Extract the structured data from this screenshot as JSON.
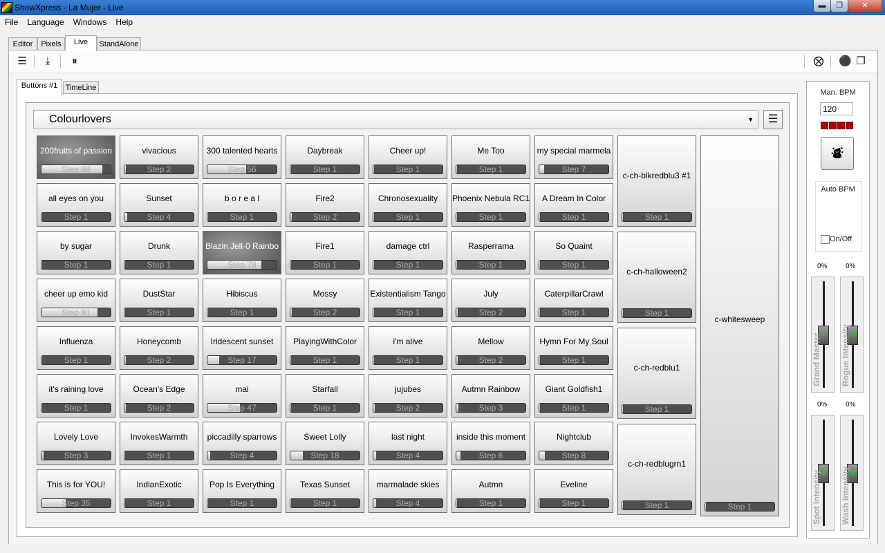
{
  "window": {
    "title": "ShowXpress - La Mujer - Live"
  },
  "menu": [
    "File",
    "Language",
    "Windows",
    "Help"
  ],
  "top_tabs": [
    "Editor",
    "Pixels",
    "Live",
    "StandAlone"
  ],
  "top_tabs_active": "Live",
  "inner_tabs": [
    "Buttons #1",
    "TimeLine"
  ],
  "inner_tabs_active": "Buttons #1",
  "page_select": {
    "value": "Colourlovers"
  },
  "grid": {
    "rows": [
      [
        {
          "name": "200fruits of passion",
          "step": "Step 88",
          "progress": 0.88,
          "active": true
        },
        {
          "name": "vivacious",
          "step": "Step 2",
          "progress": 0.02
        },
        {
          "name": "300 talented hearts",
          "step": "Step 56",
          "progress": 0.56
        },
        {
          "name": "Daybreak",
          "step": "Step 1",
          "progress": 0.01
        },
        {
          "name": "Cheer up!",
          "step": "Step 1",
          "progress": 0.01
        },
        {
          "name": "Me Too",
          "step": "Step 1",
          "progress": 0.01
        },
        {
          "name": "my special marmela",
          "step": "Step 7",
          "progress": 0.07
        }
      ],
      [
        {
          "name": "all eyes on you",
          "step": "Step 1",
          "progress": 0.01
        },
        {
          "name": "Sunset",
          "step": "Step 4",
          "progress": 0.04
        },
        {
          "name": "b o r e a l",
          "step": "Step 1",
          "progress": 0.01
        },
        {
          "name": "Fire2",
          "step": "Step 2",
          "progress": 0.02
        },
        {
          "name": "Chronosexuality",
          "step": "Step 1",
          "progress": 0.01
        },
        {
          "name": "Phoenix Nebula RC1",
          "step": "Step 1",
          "progress": 0.01
        },
        {
          "name": "A Dream In Color",
          "step": "Step 1",
          "progress": 0.01
        }
      ],
      [
        {
          "name": "by sugar",
          "step": "Step 1",
          "progress": 0.01
        },
        {
          "name": "Drunk",
          "step": "Step 1",
          "progress": 0.01
        },
        {
          "name": "Blazin Jell-0 Rainbo",
          "step": "Step 78",
          "progress": 0.78,
          "active": true
        },
        {
          "name": "Fire1",
          "step": "Step 1",
          "progress": 0.01
        },
        {
          "name": "damage ctrl",
          "step": "Step 1",
          "progress": 0.01
        },
        {
          "name": "Rasperrama",
          "step": "Step 1",
          "progress": 0.01
        },
        {
          "name": "So Quaint",
          "step": "Step 1",
          "progress": 0.01
        }
      ],
      [
        {
          "name": "cheer up emo kid",
          "step": "Step 81",
          "progress": 0.81
        },
        {
          "name": "DustStar",
          "step": "Step 1",
          "progress": 0.01
        },
        {
          "name": "Hibiscus",
          "step": "Step 1",
          "progress": 0.01
        },
        {
          "name": "Mossy",
          "step": "Step 2",
          "progress": 0.02
        },
        {
          "name": "Existentialism Tango",
          "step": "Step 1",
          "progress": 0.01
        },
        {
          "name": "July",
          "step": "Step 2",
          "progress": 0.02
        },
        {
          "name": "CaterpillarCrawl",
          "step": "Step 1",
          "progress": 0.01
        }
      ],
      [
        {
          "name": "Influenza",
          "step": "Step 1",
          "progress": 0.01
        },
        {
          "name": "Honeycomb",
          "step": "Step 2",
          "progress": 0.02
        },
        {
          "name": "Iridescent sunset",
          "step": "Step 17",
          "progress": 0.17
        },
        {
          "name": "PlayingWithColor",
          "step": "Step 1",
          "progress": 0.01
        },
        {
          "name": "i'm alive",
          "step": "Step 1",
          "progress": 0.01
        },
        {
          "name": "Mellow",
          "step": "Step 2",
          "progress": 0.02
        },
        {
          "name": "Hymn For My Soul",
          "step": "Step 1",
          "progress": 0.01
        }
      ],
      [
        {
          "name": "it's raining love",
          "step": "Step 1",
          "progress": 0.01
        },
        {
          "name": "Ocean's Edge",
          "step": "Step 2",
          "progress": 0.02
        },
        {
          "name": "mai",
          "step": "Step 47",
          "progress": 0.47
        },
        {
          "name": "Starfall",
          "step": "Step 1",
          "progress": 0.01
        },
        {
          "name": "jujubes",
          "step": "Step 2",
          "progress": 0.02
        },
        {
          "name": "Autmn Rainbow",
          "step": "Step 3",
          "progress": 0.03
        },
        {
          "name": "Giant Goldfish1",
          "step": "Step 1",
          "progress": 0.01
        }
      ],
      [
        {
          "name": "Lovely Love",
          "step": "Step 3",
          "progress": 0.03
        },
        {
          "name": "InvokesWarmth",
          "step": "Step 1",
          "progress": 0.01
        },
        {
          "name": "piccadilly sparrows",
          "step": "Step 4",
          "progress": 0.04
        },
        {
          "name": "Sweet Lolly",
          "step": "Step 18",
          "progress": 0.18
        },
        {
          "name": "last night",
          "step": "Step 4",
          "progress": 0.04
        },
        {
          "name": "inside this moment",
          "step": "Step 6",
          "progress": 0.06
        },
        {
          "name": "Nightclub",
          "step": "Step 8",
          "progress": 0.08
        }
      ],
      [
        {
          "name": "This is for YOU!",
          "step": "Step 35",
          "progress": 0.35
        },
        {
          "name": "IndianExotic",
          "step": "Step 1",
          "progress": 0.01
        },
        {
          "name": "Pop Is Everything",
          "step": "Step 1",
          "progress": 0.01
        },
        {
          "name": "Texas Sunset",
          "step": "Step 1",
          "progress": 0.01
        },
        {
          "name": "marmalade skies",
          "step": "Step 4",
          "progress": 0.04
        },
        {
          "name": "Autmn",
          "step": "Step 1",
          "progress": 0.01
        },
        {
          "name": "Eveline",
          "step": "Step 1",
          "progress": 0.01
        }
      ]
    ],
    "tall_buttons": [
      {
        "name": "c-ch-blkredblu3 #1",
        "step": "Step 1",
        "progress": 0.01
      },
      {
        "name": "c-ch-halloween2",
        "step": "Step 1",
        "progress": 0.01
      },
      {
        "name": "c-ch-redblu1",
        "step": "Step 1",
        "progress": 0.01
      },
      {
        "name": "c-ch-redblugrn1",
        "step": "Step 1",
        "progress": 0.01
      }
    ],
    "big_button": {
      "name": "c-whitesweep",
      "step": "Step 1",
      "progress": 0.01
    }
  },
  "right_panel": {
    "man_bpm_label": "Man. BPM",
    "man_bpm_value": "120",
    "auto_bpm_label": "Auto BPM",
    "onoff_label": "On/Off",
    "faders": [
      {
        "label": "Grand Master",
        "percent": "0%",
        "level": 0.0
      },
      {
        "label": "Rogue Intensity",
        "percent": "0%",
        "level": 0.0
      },
      {
        "label": "Spot Intensity",
        "percent": "0%",
        "level": 0.0
      },
      {
        "label": "Wash Intensity",
        "percent": "0%",
        "level": 0.0
      }
    ]
  },
  "icons": {
    "toolbar": [
      "menu-icon",
      "download-icon",
      "pause-icon"
    ],
    "toolbar_right": [
      "close-circle-icon",
      "dmx-icon",
      "windows-icon"
    ],
    "tap": "drum-icon"
  },
  "colors": {
    "title_bar": "#1e5fb7",
    "led": "#b00000",
    "fader_cross": "#00e000",
    "active_button": "#5a5a5a"
  }
}
